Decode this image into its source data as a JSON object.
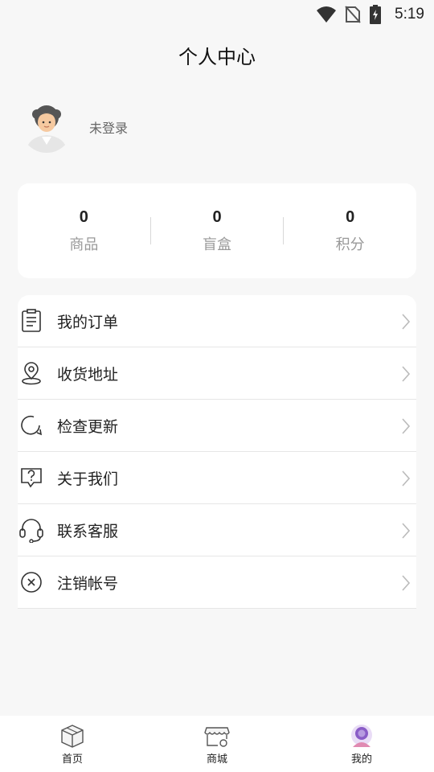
{
  "status_bar": {
    "time": "5:19",
    "icons": [
      "wifi-icon",
      "no-sim-icon",
      "battery-charging-icon"
    ]
  },
  "header": {
    "title": "个人中心"
  },
  "profile": {
    "avatar_icon": "avatar-icon",
    "login_status": "未登录"
  },
  "stats": [
    {
      "value": "0",
      "label": "商品"
    },
    {
      "value": "0",
      "label": "盲盒"
    },
    {
      "value": "0",
      "label": "积分"
    }
  ],
  "menu": [
    {
      "label": "我的订单",
      "icon": "order-list-icon"
    },
    {
      "label": "收货地址",
      "icon": "location-pin-icon"
    },
    {
      "label": "检查更新",
      "icon": "refresh-icon"
    },
    {
      "label": "关于我们",
      "icon": "help-icon"
    },
    {
      "label": "联系客服",
      "icon": "headset-icon"
    },
    {
      "label": "注销帐号",
      "icon": "close-circle-icon"
    }
  ],
  "tabbar": [
    {
      "label": "首页",
      "icon": "home-box-icon"
    },
    {
      "label": "商城",
      "icon": "store-icon"
    },
    {
      "label": "我的",
      "icon": "profile-icon",
      "active": true
    }
  ],
  "colors": {
    "background": "#f7f7f7",
    "card": "#ffffff",
    "accent": "#8a5cc7",
    "muted_text": "#999999"
  }
}
